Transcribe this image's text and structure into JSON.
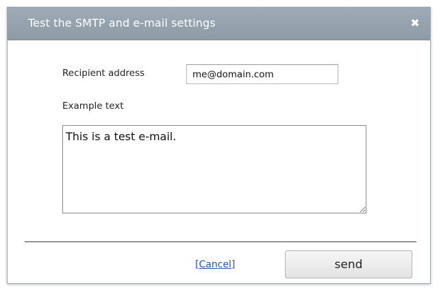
{
  "dialog": {
    "title": "Test the SMTP and e-mail settings",
    "close_icon": "close-icon",
    "close_glyph": "✖"
  },
  "form": {
    "recipient_label": "Recipient address",
    "recipient_value": "me@domain.com",
    "example_label": "Example text",
    "example_value": "This is a test e-mail."
  },
  "actions": {
    "cancel_label": "[Cancel]",
    "send_label": "send"
  },
  "colors": {
    "titlebar": "#98a4b0",
    "link": "#1f55b4"
  }
}
